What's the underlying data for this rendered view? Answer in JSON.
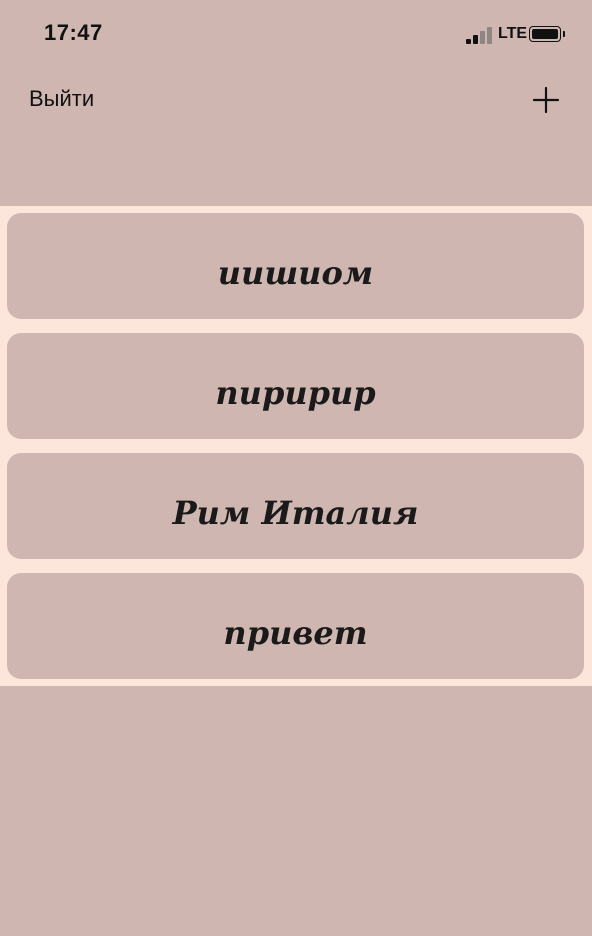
{
  "status_bar": {
    "time": "17:47",
    "network": "LTE",
    "signal_bars_active": 2,
    "signal_bars_total": 4,
    "battery_level": 1.0
  },
  "nav": {
    "logout_label": "Выйти",
    "add_icon": "plus-icon"
  },
  "list": {
    "items": [
      {
        "label": "иишиом"
      },
      {
        "label": "пиририр"
      },
      {
        "label": "Рим Италия"
      },
      {
        "label": "привет"
      }
    ]
  },
  "colors": {
    "background": "#CFB6B0",
    "list_background": "#FCE5DA",
    "card": "#CFB6B0",
    "text": "#111111"
  }
}
